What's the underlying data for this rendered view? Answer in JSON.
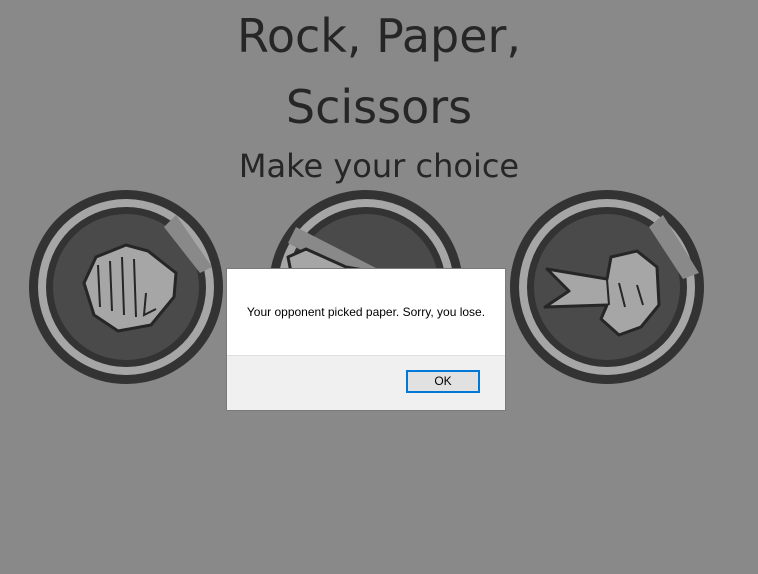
{
  "page": {
    "title_line1": "Rock, Paper,",
    "title_line2": "Scissors",
    "subtitle": "Make your choice"
  },
  "choices": [
    {
      "id": "rock",
      "icon": "fist-icon"
    },
    {
      "id": "paper",
      "icon": "open-hand-icon"
    },
    {
      "id": "scissors",
      "icon": "scissors-hand-icon"
    }
  ],
  "alert": {
    "message": "Your opponent picked paper. Sorry, you lose.",
    "ok_label": "OK"
  },
  "colors": {
    "background": "#898989",
    "icon_dark": "#333333",
    "icon_mid": "#4a4a4a",
    "icon_light": "#a6a6a6",
    "accent": "#0078d7"
  }
}
